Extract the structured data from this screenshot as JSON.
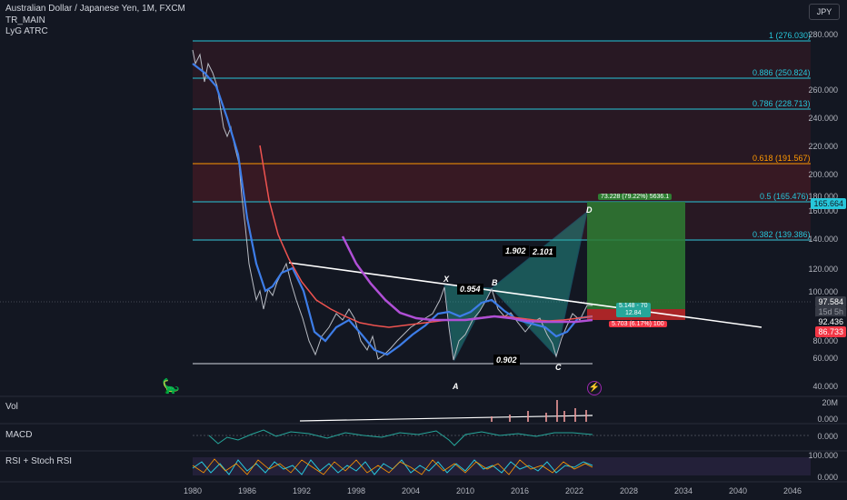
{
  "header": {
    "symbol_line": "Australian Dollar / Japanese Yen, 1M, FXCM",
    "indicator_1": "TR_MAIN",
    "indicator_2": "LyG ATRC",
    "currency": "JPY"
  },
  "panes": {
    "vol_label": "Vol",
    "macd_label": "MACD",
    "rsi_label": "RSI + Stoch RSI"
  },
  "price_axis": [
    "280.000",
    "260.000",
    "240.000",
    "220.000",
    "200.000",
    "180.000",
    "160.000",
    "140.000",
    "120.000",
    "100.000",
    "80.000",
    "60.000",
    "40.000"
  ],
  "vol_axis": [
    "20M",
    "0.000"
  ],
  "macd_axis": [
    "0.000"
  ],
  "rsi_axis": [
    "100.000",
    "0.000"
  ],
  "time_axis": [
    "1980",
    "1986",
    "1992",
    "1998",
    "2004",
    "2010",
    "2016",
    "2022",
    "2028",
    "2034",
    "2040",
    "2046"
  ],
  "fib_levels": [
    {
      "label": "1 (276.030)",
      "color": "#26c6da"
    },
    {
      "label": "0.886 (250.824)",
      "color": "#26c6da"
    },
    {
      "label": "0.786 (228.713)",
      "color": "#26c6da"
    },
    {
      "label": "0.618 (191.567)",
      "color": "#ff9800"
    },
    {
      "label": "0.5 (165.476)",
      "color": "#26c6da"
    },
    {
      "label": "0.382 (139.386)",
      "color": "#26c6da"
    }
  ],
  "pattern_labels": {
    "x": "X",
    "a": "A",
    "b": "B",
    "c": "C",
    "d": "D",
    "xb": "0.954",
    "ac": "0.902",
    "bd1": "1.902",
    "bd2": "2.101"
  },
  "price_badges": {
    "target": "165.664",
    "last": "97.584",
    "countdown": "15d 5h",
    "mid": "92.436",
    "low": "86.733"
  },
  "trade_box": {
    "profit": "73.228 (79.22%) 5636.1",
    "center_1": "5.148 - 70",
    "center_2": "12.84",
    "stop": "5.703 (6.17%) 100"
  }
}
